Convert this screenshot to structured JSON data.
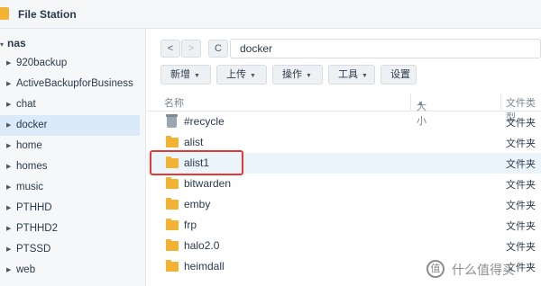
{
  "app": {
    "title": "File Station"
  },
  "sidebar": {
    "root_label": "nas",
    "items": [
      {
        "label": "920backup"
      },
      {
        "label": "ActiveBackupforBusiness"
      },
      {
        "label": "chat"
      },
      {
        "label": "docker",
        "selected": true
      },
      {
        "label": "home"
      },
      {
        "label": "homes"
      },
      {
        "label": "music"
      },
      {
        "label": "PTHHD"
      },
      {
        "label": "PTHHD2"
      },
      {
        "label": "PTSSD"
      },
      {
        "label": "web"
      }
    ]
  },
  "nav": {
    "back_icon": "chevron-left-icon",
    "forward_icon": "chevron-right-icon",
    "refresh_icon": "refresh-icon",
    "path": "docker"
  },
  "toolbar": {
    "create": "新增",
    "upload": "上传",
    "action": "操作",
    "tools": "工具",
    "settings": "设置"
  },
  "columns": {
    "name": "名称",
    "size": "大小",
    "type": "文件类型"
  },
  "files": [
    {
      "name": "#recycle",
      "type": "文件夹",
      "icon": "trash-icon"
    },
    {
      "name": "alist",
      "type": "文件夹",
      "icon": "folder-icon"
    },
    {
      "name": "alist1",
      "type": "文件夹",
      "icon": "folder-icon",
      "highlighted": true
    },
    {
      "name": "bitwarden",
      "type": "文件夹",
      "icon": "folder-icon"
    },
    {
      "name": "emby",
      "type": "文件夹",
      "icon": "folder-icon"
    },
    {
      "name": "frp",
      "type": "文件夹",
      "icon": "folder-icon"
    },
    {
      "name": "halo2.0",
      "type": "文件夹",
      "icon": "folder-icon"
    },
    {
      "name": "heimdall",
      "type": "文件夹",
      "icon": "folder-icon"
    }
  ],
  "watermark": {
    "icon": "值",
    "text": "什么值得买"
  },
  "colors": {
    "accent": "#dbeaf8",
    "folder": "#f2b234",
    "highlight": "#e53935"
  }
}
